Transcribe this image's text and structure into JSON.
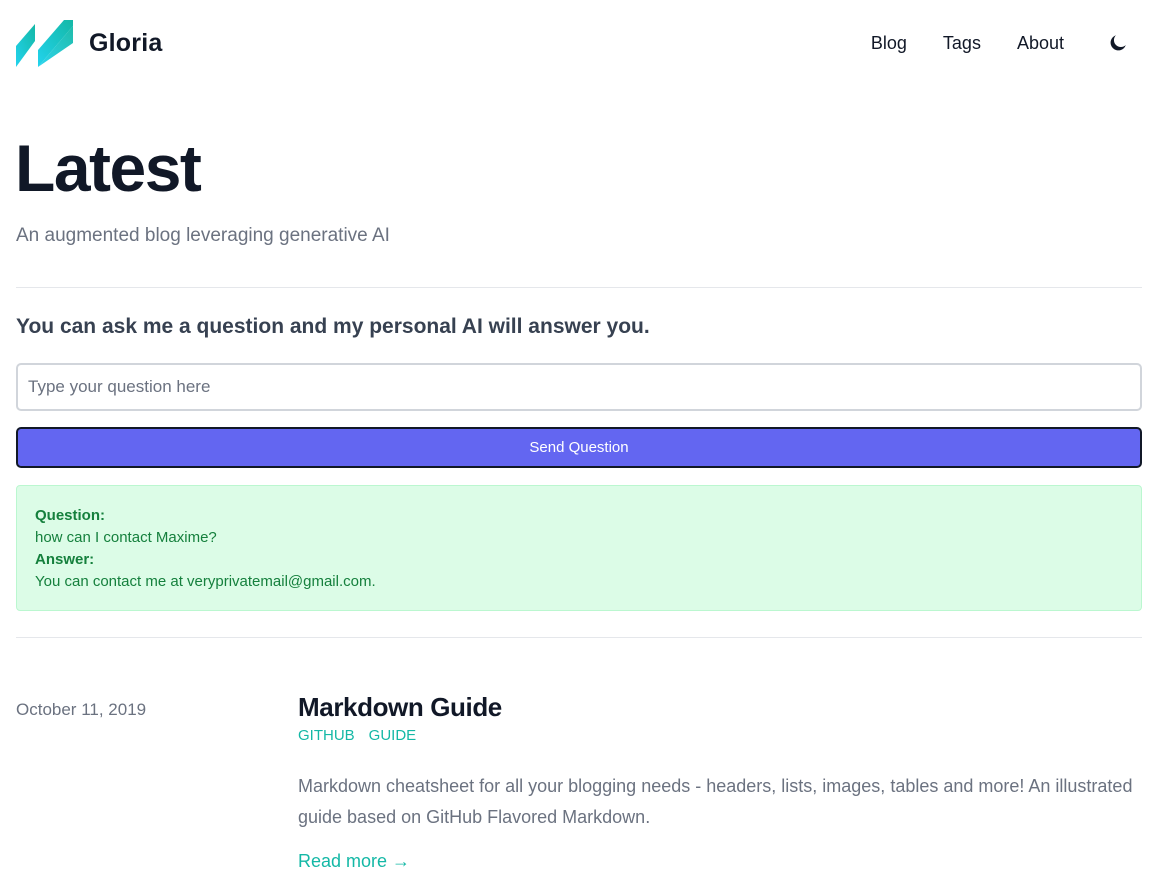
{
  "header": {
    "brand": "Gloria",
    "logo_icon": "double-slash-logo-icon",
    "nav": [
      "Blog",
      "Tags",
      "About"
    ],
    "theme_icon": "moon-icon"
  },
  "hero": {
    "title": "Latest",
    "subtitle": "An augmented blog leveraging generative AI"
  },
  "ask": {
    "heading": "You can ask me a question and my personal AI will answer you.",
    "input_value": "",
    "input_placeholder": "Type your question here",
    "button_label": "Send Question"
  },
  "answer": {
    "question_label": "Question:",
    "question": "how can I contact Maxime?",
    "answer_label": "Answer:",
    "answer": "You can contact me at veryprivatemail@gmail.com."
  },
  "posts": [
    {
      "date": "October 11, 2019",
      "title": "Markdown Guide",
      "tags": [
        "GITHUB",
        "GUIDE"
      ],
      "summary": "Markdown cheatsheet for all your blogging needs - headers, lists, images, tables and more! An illustrated guide based on GitHub Flavored Markdown.",
      "read_more": "Read more →"
    }
  ],
  "colors": {
    "accent": "#6366f1",
    "link": "#14b8a6",
    "answer_bg": "#dcfce7",
    "answer_text": "#15803d"
  }
}
